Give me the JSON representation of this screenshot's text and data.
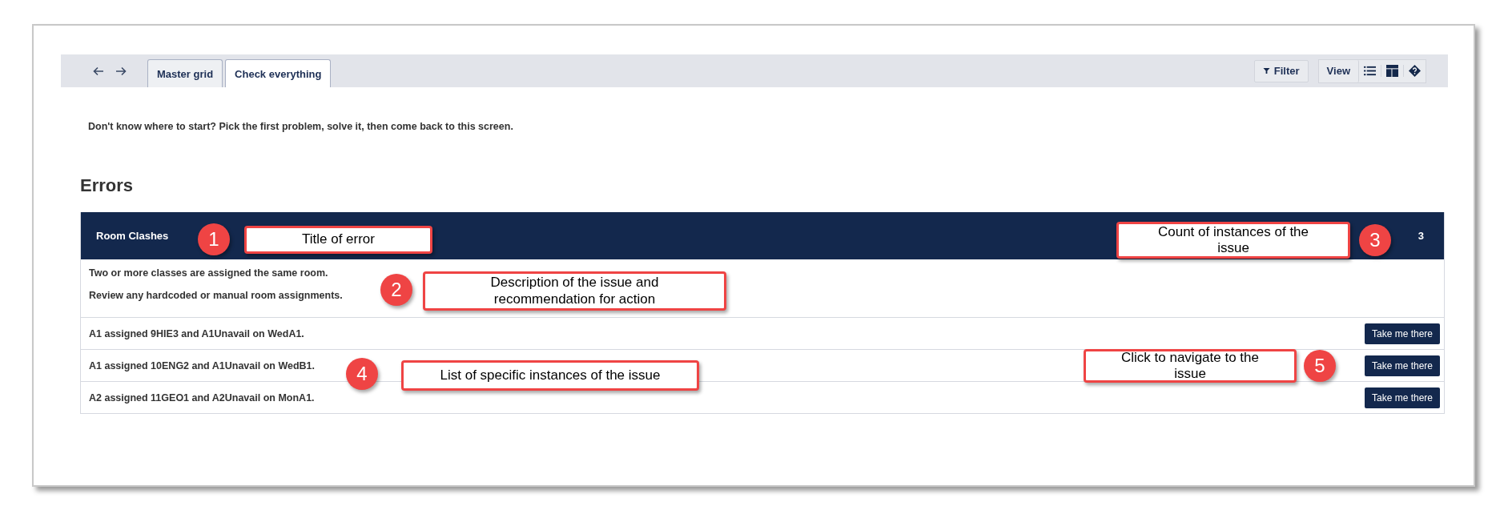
{
  "toolbar": {
    "tabs": [
      {
        "label": "Master grid",
        "selected": false
      },
      {
        "label": "Check everything",
        "selected": true
      }
    ],
    "filter_button": "Filter",
    "view_button": "View"
  },
  "intro": "Don't know where to start? Pick the first problem, solve it, then come back to this screen.",
  "section_title": "Errors",
  "error_group": {
    "title": "Room Clashes",
    "count": "3",
    "description": [
      "Two or more classes are assigned the same room.",
      "Review any hardcoded or manual room assignments."
    ],
    "instances": [
      {
        "text": "A1 assigned 9HIE3 and A1Unavail on WedA1.",
        "button": "Take me there"
      },
      {
        "text": "A1 assigned 10ENG2 and A1Unavail on WedB1.",
        "button": "Take me there"
      },
      {
        "text": "A2 assigned 11GEO1 and A2Unavail on MonA1.",
        "button": "Take me there"
      }
    ]
  },
  "annotations": [
    {
      "number": "1",
      "text": "Title of error"
    },
    {
      "number": "2",
      "text": "Description of the issue and recommendation for action"
    },
    {
      "number": "3",
      "text": "Count of instances of the issue"
    },
    {
      "number": "4",
      "text": "List of specific instances of the issue"
    },
    {
      "number": "5",
      "text": "Click to navigate to the issue"
    }
  ]
}
